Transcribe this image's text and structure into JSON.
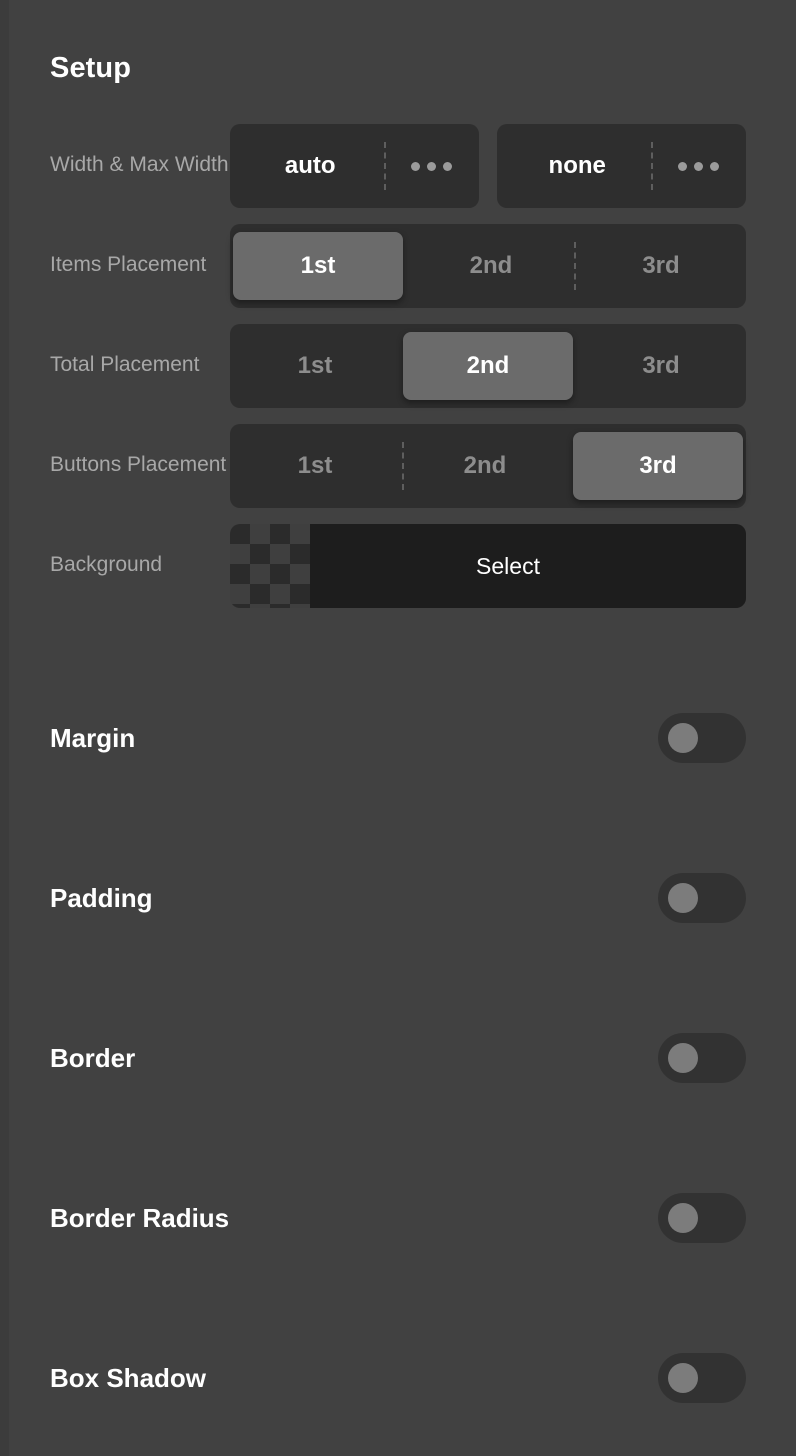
{
  "page": {
    "title": "Setup"
  },
  "setup_rows": [
    {
      "label": "Width & Max Width",
      "type": "value-pair",
      "values": [
        {
          "value": "auto",
          "menu_icon": "ellipsis-icon"
        },
        {
          "value": "none",
          "menu_icon": "ellipsis-icon"
        }
      ]
    },
    {
      "label": "Items Placement",
      "type": "segmented",
      "options": [
        "1st",
        "2nd",
        "3rd"
      ],
      "selected": "1st",
      "selected_index": 0
    },
    {
      "label": "Total Placement",
      "type": "segmented",
      "options": [
        "1st",
        "2nd",
        "3rd"
      ],
      "selected": "2nd",
      "selected_index": 1
    },
    {
      "label": "Buttons Placement",
      "type": "segmented",
      "options": [
        "1st",
        "2nd",
        "3rd"
      ],
      "selected": "3rd",
      "selected_index": 2
    },
    {
      "label": "Background",
      "type": "color-select",
      "button_label": "Select",
      "swatch": "transparent-checkerboard"
    }
  ],
  "toggle_sections": [
    {
      "title": "Margin",
      "enabled": false
    },
    {
      "title": "Padding",
      "enabled": false
    },
    {
      "title": "Border",
      "enabled": false
    },
    {
      "title": "Border Radius",
      "enabled": false
    },
    {
      "title": "Box Shadow",
      "enabled": false
    }
  ],
  "colors": {
    "background": "#414141",
    "control_track": "#2e2e2e",
    "control_thumb": "#6b6b6b",
    "select_area": "#1d1d1d",
    "label_muted": "#a8a8a8",
    "text_primary": "#ffffff",
    "switch_track_off": "#323232",
    "switch_knob_off": "#7c7c7c"
  }
}
